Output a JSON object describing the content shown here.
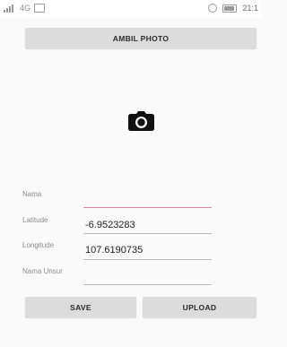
{
  "statusbar": {
    "network": "4G",
    "time": "21:1"
  },
  "buttons": {
    "photo": "AMBIL PHOTO",
    "save": "SAVE",
    "upload": "UPLOAD"
  },
  "form": {
    "nama": {
      "label": "Nama",
      "value": ""
    },
    "latitude": {
      "label": "Latitude",
      "value": "-6.9523283"
    },
    "longitude": {
      "label": "Longitude",
      "value": "107.6190735"
    },
    "nama_unsur": {
      "label": "Nama Unsur",
      "value": ""
    }
  },
  "icons": {
    "photo_placeholder": "camera-icon"
  },
  "colors": {
    "active_underline": "#e08aa0",
    "button_bg": "#dcdcdc"
  }
}
